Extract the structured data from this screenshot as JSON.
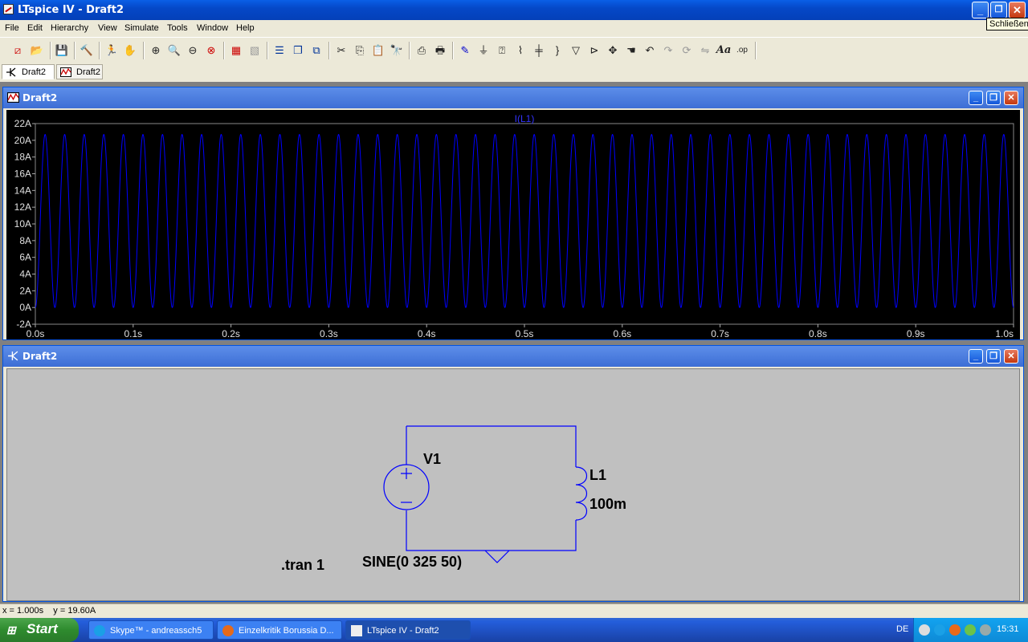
{
  "app": {
    "title": "LTspice IV - Draft2",
    "tooltip": "Schließen",
    "close_symbol": "✕",
    "maximize_symbol": "❐",
    "minimize_symbol": "_"
  },
  "menu": [
    "File",
    "Edit",
    "Hierarchy",
    "View",
    "Simulate",
    "Tools",
    "Window",
    "Help"
  ],
  "tabs": [
    {
      "label": "Draft2",
      "icon": "schematic-icon"
    },
    {
      "label": "Draft2",
      "icon": "waveform-icon"
    }
  ],
  "plot_window": {
    "title": "Draft2",
    "trace_name": "I(L1)"
  },
  "schematic_window": {
    "title": "Draft2",
    "source_name": "V1",
    "source_value": "SINE(0 325 50)",
    "inductor_name": "L1",
    "inductor_value": "100m",
    "directive": ".tran 1"
  },
  "chart_data": {
    "type": "line",
    "title": "I(L1)",
    "xlabel": "",
    "ylabel": "",
    "xlim": [
      0.0,
      1.0
    ],
    "ylim": [
      -2,
      22
    ],
    "x_ticks": [
      "0.0s",
      "0.1s",
      "0.2s",
      "0.3s",
      "0.4s",
      "0.5s",
      "0.6s",
      "0.7s",
      "0.8s",
      "0.9s",
      "1.0s"
    ],
    "y_ticks": [
      "22A",
      "20A",
      "18A",
      "16A",
      "14A",
      "12A",
      "10A",
      "8A",
      "6A",
      "4A",
      "2A",
      "0A",
      "-2A"
    ],
    "series": [
      {
        "name": "I(L1)",
        "color": "#0000ff",
        "function": "10.35*(1-cos(2*pi*50*t))",
        "frequency_hz": 50,
        "min": 0,
        "max": 20.7
      }
    ],
    "background": "#000000",
    "grid": false
  },
  "status": {
    "cursor": "x = 1.000s    y = 19.60A"
  },
  "taskbar": {
    "start": "Start",
    "tasks": [
      {
        "label": "Skype™ - andreassch5",
        "color": "#1aa0e6"
      },
      {
        "label": "Einzelkritik Borussia D...",
        "color": "#e66a1a"
      },
      {
        "label": "LTspice IV - Draft2",
        "color": "#cc2222"
      }
    ],
    "language": "DE",
    "clock": "15:31"
  },
  "colors": {
    "title_blue": "#0548c8",
    "child_caption": "#3d6ed5",
    "trace": "#0000ff",
    "schematic_wire": "#0000ff",
    "schematic_bg": "#c0c0c0"
  }
}
